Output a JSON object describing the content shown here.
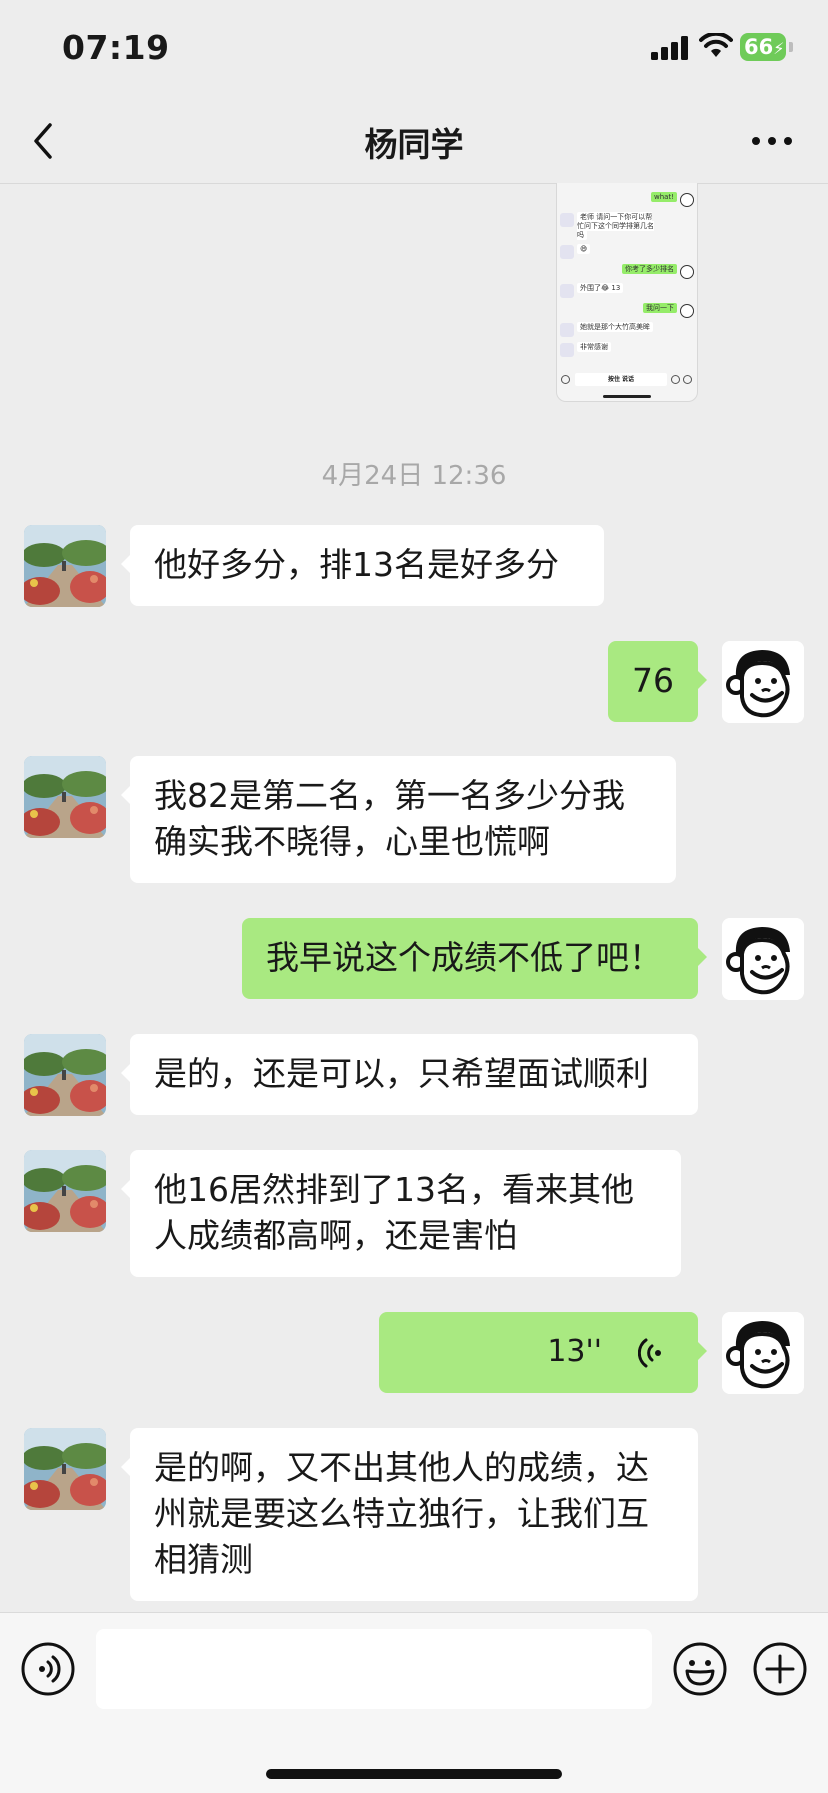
{
  "status_bar": {
    "time": "07:19",
    "battery": "66"
  },
  "nav": {
    "title": "杨同学"
  },
  "thumbnail": {
    "rows": [
      {
        "dir": "out",
        "text": "what!"
      },
      {
        "dir": "in",
        "text": "老师 请问一下你可以帮忙问下这个同学排第几名吗"
      },
      {
        "dir": "in",
        "text": "😄"
      },
      {
        "dir": "out",
        "text": "你考了多少排名"
      },
      {
        "dir": "in",
        "text": "外围了😂 13"
      },
      {
        "dir": "out",
        "text": "我问一下"
      },
      {
        "dir": "in",
        "text": "她就是那个大竹高美眸"
      },
      {
        "dir": "in",
        "text": "非常感谢"
      }
    ],
    "input_label": "按住 说话"
  },
  "timestamp": "4月24日 12:36",
  "messages": [
    {
      "dir": "in",
      "lines": [
        "他好多分，排13名是好多分"
      ]
    },
    {
      "dir": "out",
      "lines": [
        "76"
      ]
    },
    {
      "dir": "in",
      "lines": [
        "我82是第二名，第一名多少分我",
        "确实我不晓得，心里也慌啊"
      ]
    },
    {
      "dir": "out",
      "lines": [
        "我早说这个成绩不低了吧！"
      ]
    },
    {
      "dir": "in",
      "lines": [
        "是的，还是可以，只希望面试顺利"
      ]
    },
    {
      "dir": "in",
      "lines": [
        "他16居然排到了13名，看来其他",
        "人成绩都高啊，还是害怕"
      ]
    },
    {
      "dir": "out",
      "voice": "13''"
    },
    {
      "dir": "in",
      "lines": [
        "是的啊，又不出其他人的成绩，达",
        "州就是要这么特立独行，让我们互",
        "相猜测"
      ]
    }
  ],
  "input": {
    "value": "",
    "placeholder": ""
  },
  "icons": {
    "back": "chevron-left-icon",
    "more": "more-horizontal-icon",
    "voice": "voice-mode-icon",
    "emoji": "emoji-icon",
    "plus": "plus-icon"
  },
  "colors": {
    "bubble_out": "#a9e981",
    "bubble_in": "#ffffff",
    "background": "#ededed"
  }
}
